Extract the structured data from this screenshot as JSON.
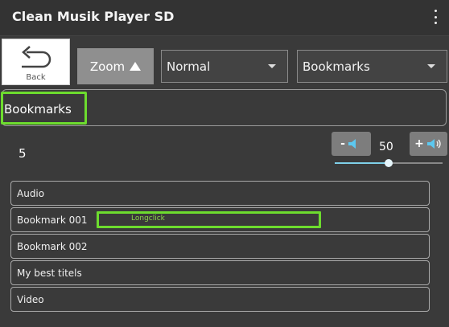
{
  "app": {
    "title": "Clean Musik Player SD"
  },
  "toolbar": {
    "back_label": "Back",
    "zoom_label": "Zoom",
    "mode_select": {
      "value": "Normal"
    },
    "list_select": {
      "value": "Bookmarks"
    }
  },
  "header": {
    "title": "Bookmarks"
  },
  "status": {
    "count": "5"
  },
  "volume": {
    "minus_label": "-",
    "plus_label": "+",
    "value": "50",
    "level_percent": 50
  },
  "bookmarks": [
    {
      "label": "Audio"
    },
    {
      "label": "Bookmark 001"
    },
    {
      "label": "Bookmark 002"
    },
    {
      "label": "My best titels"
    },
    {
      "label": "Video"
    }
  ],
  "annotations": {
    "longclick": "Longclick"
  },
  "colors": {
    "highlight": "#6ddc2e",
    "slider_accent": "#7fd0e8"
  },
  "icons": {
    "back": "back-arrow-icon",
    "zoom": "triangle-up-icon",
    "overflow": "more-vert-icon",
    "volume": "speaker-icon"
  }
}
